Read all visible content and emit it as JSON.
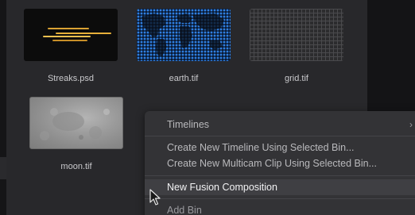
{
  "bin": {
    "clips": [
      {
        "name": "Streaks.psd",
        "icon": "streaks-thumbnail"
      },
      {
        "name": "earth.tif",
        "icon": "earth-map-thumbnail"
      },
      {
        "name": "grid.tif",
        "icon": "grid-thumbnail"
      },
      {
        "name": "moon.tif",
        "icon": "moon-surface-thumbnail"
      }
    ]
  },
  "context_menu": {
    "items": [
      {
        "label": "Timelines",
        "has_submenu": true
      },
      {
        "label": "Create New Timeline Using Selected Bin..."
      },
      {
        "label": "Create New Multicam Clip Using Selected Bin..."
      },
      {
        "label": "New Fusion Composition",
        "highlighted": true
      },
      {
        "label": "Add Bin"
      }
    ],
    "submenu_glyph": "›"
  },
  "colors": {
    "bin_background": "#28282b",
    "menu_background": "#333336",
    "highlight_text": "#f2f2f4",
    "streak_gold": "#e8b03a",
    "earth_blue": "#2f7fe0"
  }
}
